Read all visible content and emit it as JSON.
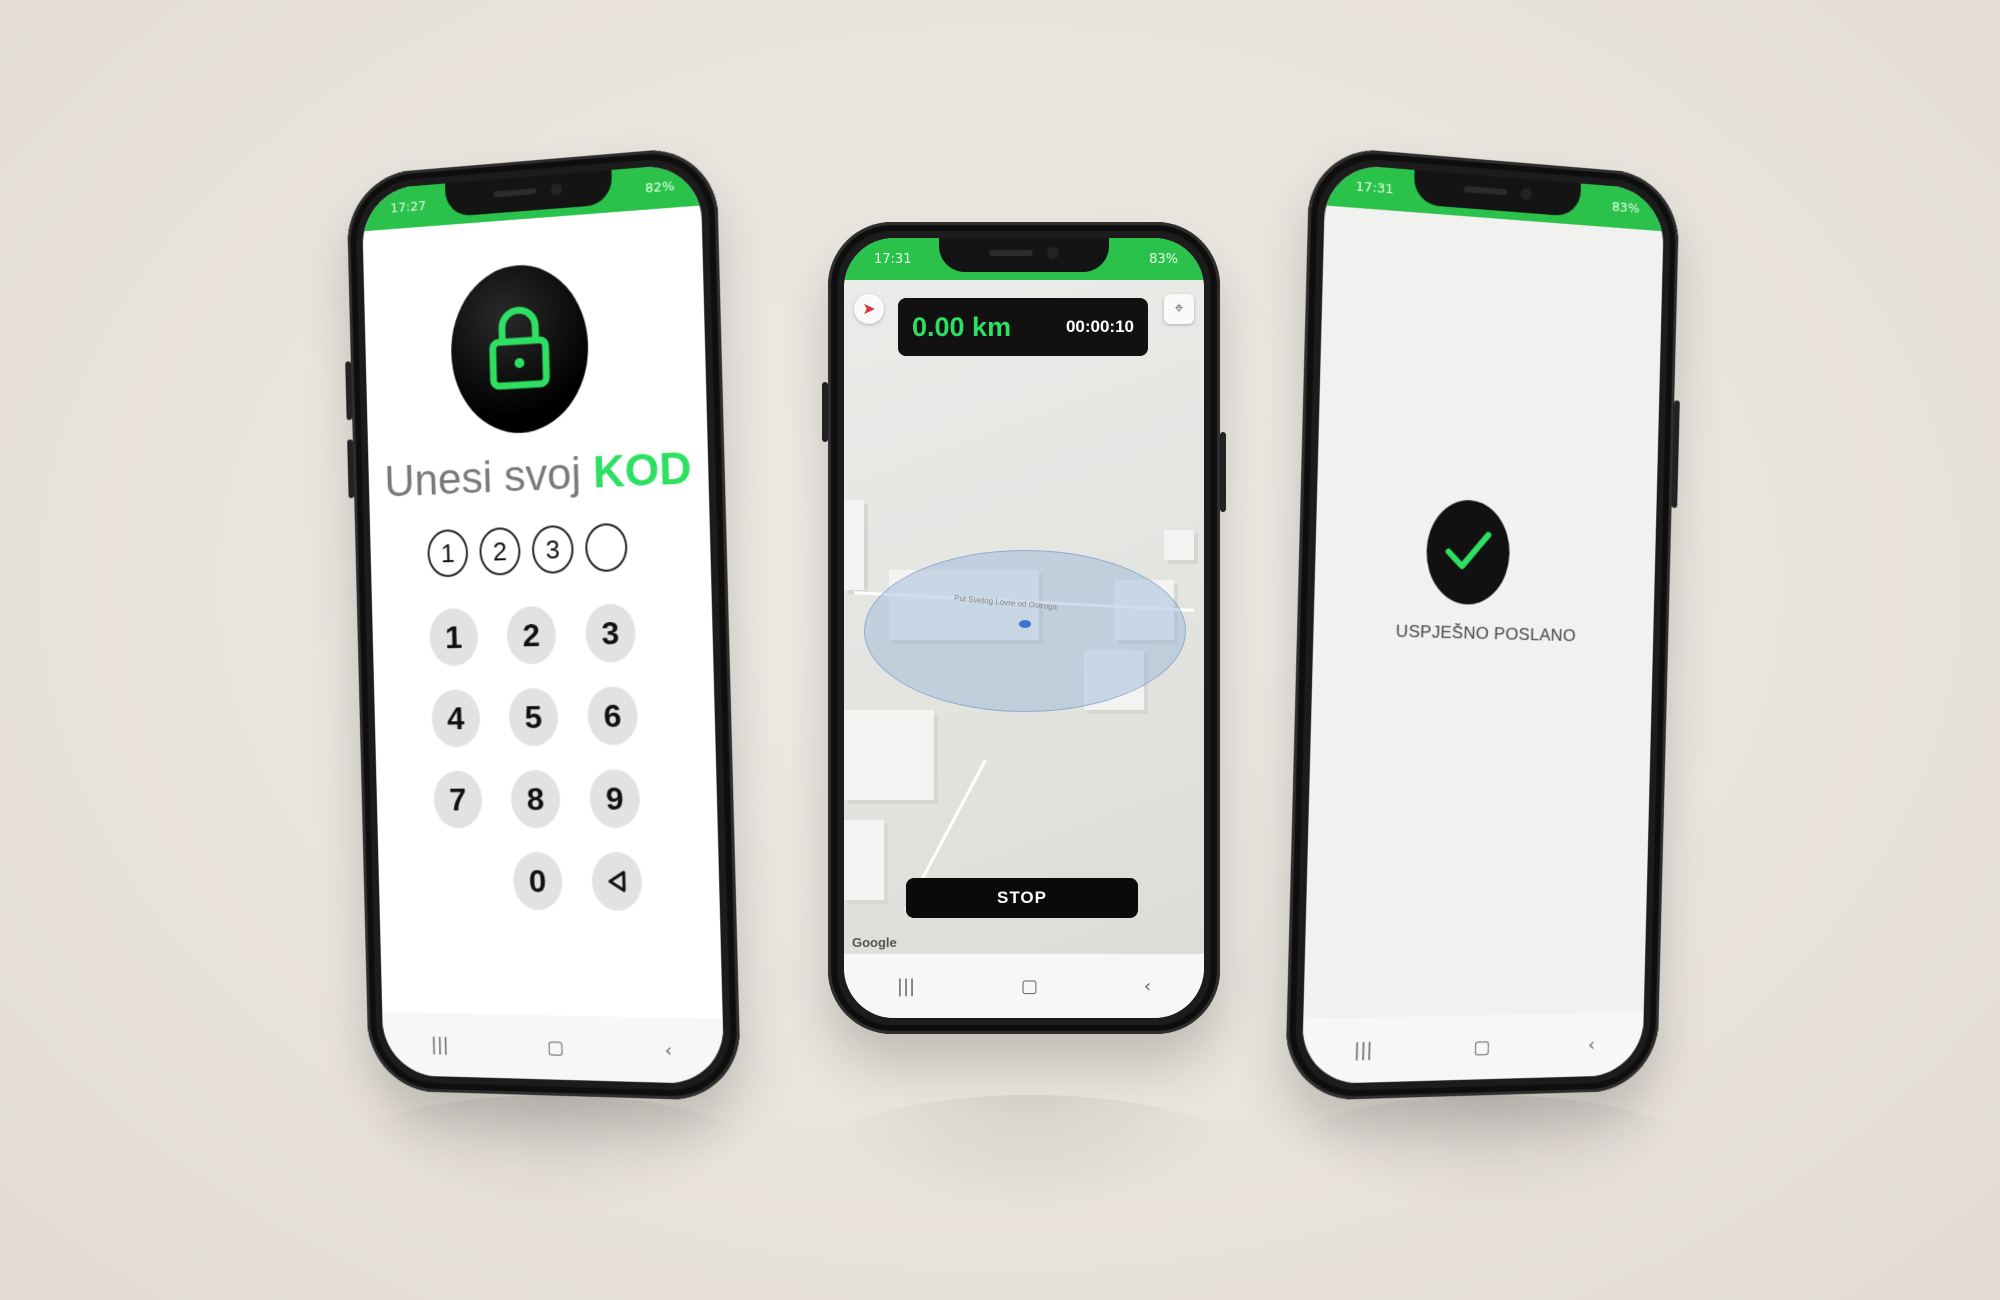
{
  "left_screen": {
    "status_time": "17:27",
    "status_battery": "82%",
    "title_prefix": "Unesi svoj",
    "title_highlight": "KOD",
    "code_slots": [
      "1",
      "2",
      "3",
      ""
    ],
    "keys": [
      "1",
      "2",
      "3",
      "4",
      "5",
      "6",
      "7",
      "8",
      "9",
      "0"
    ],
    "backspace_icon": "backspace-triangle-icon",
    "lock_icon": "padlock-icon"
  },
  "middle_screen": {
    "status_time": "17:31",
    "status_battery": "83%",
    "distance": "0.00 km",
    "timer": "00:00:10",
    "street_label": "Put Svetog Lovre od Ostroga",
    "stop_label": "STOP",
    "map_attribution": "Google"
  },
  "right_screen": {
    "status_time": "17:31",
    "status_battery": "83%",
    "message": "USPJEŠNO POSLANO"
  },
  "navbar": {
    "recents": "|||",
    "home": "▢",
    "back": "‹"
  },
  "colors": {
    "accent_green": "#2ee062",
    "statusbar_green": "#2bc24c",
    "dark": "#111111"
  }
}
